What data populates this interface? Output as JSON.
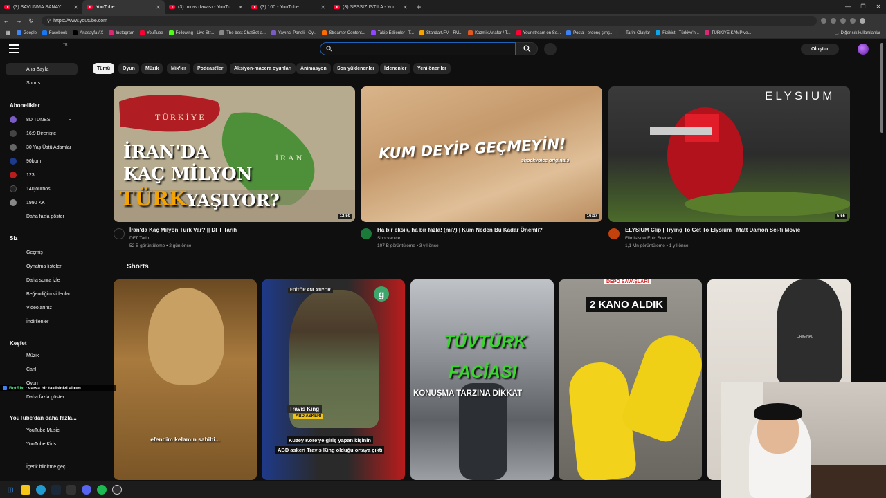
{
  "browser": {
    "tabs": [
      {
        "title": "(3) SAVUNMA SANAYİ UZMANI, E"
      },
      {
        "title": "YouTube"
      },
      {
        "title": "(3) miras davası - YouTube"
      },
      {
        "title": "(3) 100 - YouTube"
      },
      {
        "title": "(3) SESSİZ İSTİLA - YouTube"
      }
    ],
    "url": "https://www.youtube.com",
    "bookmarks": [
      "Google",
      "Facebook",
      "Anasayfa / X",
      "Instagram",
      "YouTube",
      "Following - Live Str...",
      "The best ChatBot a...",
      "Yayıncı Paneli - Oy...",
      "Streamer Content...",
      "Takip Edilenler - T...",
      "Standart.FM - FM...",
      "Kozmik Anafor / T...",
      "Your stream on So...",
      "Posta - erdenç şimş...",
      "Tarihi Olaylar",
      "Fizikist - Türkiye'n...",
      "TÜRKİYE KAMP ve..."
    ],
    "other_bookmarks": "Diğer sık kullanılanlar"
  },
  "header": {
    "country": "TR",
    "search_value": "",
    "create_label": "Oluştur"
  },
  "sidebar": {
    "home": "Ana Sayfa",
    "shorts": "Shorts",
    "subs_header": "Abonelikler",
    "subscriptions": [
      "8D TUNES",
      "16:9 Direnişte",
      "30 Yaş Üstü Adamlar",
      "90bpm",
      "123",
      "140journos",
      "1990 KK"
    ],
    "show_more": "Daha fazla göster",
    "you_header": "Siz",
    "you_items": [
      "Geçmiş",
      "Oynatma listeleri",
      "Daha sonra izle",
      "Beğendiğim videolar",
      "Videolarınız",
      "İndirilenler"
    ],
    "explore_header": "Keşfet",
    "explore_items": [
      "Müzik",
      "Canlı",
      "Oyun"
    ],
    "explore_more": "Daha fazla göster",
    "more_yt_header": "YouTube'dan daha fazla...",
    "more_yt_items": [
      "YouTube Music",
      "YouTube Kids"
    ],
    "report": "İçerik bildirme geç..."
  },
  "chips": [
    "Tümü",
    "Oyun",
    "Müzik",
    "Mix'ler",
    "Podcast'ler",
    "Aksiyon-macera oyunları",
    "Animasyon",
    "Son yüklenenler",
    "İzlenenler",
    "Yeni öneriler"
  ],
  "videos": [
    {
      "title": "İran'da Kaç Milyon Türk Var? || DFT Tarih",
      "channel": "DFT Tarih",
      "meta": "52 B görüntüleme • 2 gün önce",
      "duration": "12:50",
      "thumb_text_1": "İRAN'DA",
      "thumb_text_2": "KAÇ MİLYON",
      "thumb_text_3": "TÜRK",
      "thumb_text_4": "YAŞIYOR?",
      "map_label_1": "TÜRKİYE",
      "map_label_2": "İRAN"
    },
    {
      "title": "Ha bir eksik, ha bir fazla! (mı?) | Kum Neden Bu Kadar Önemli?",
      "channel": "Shockvoice",
      "meta": "107 B görüntüleme • 3 yıl önce",
      "duration": "16:17",
      "thumb_text_1": "KUM DEYİP GEÇMEYİN!",
      "thumb_text_2": "shockvoice originals"
    },
    {
      "title": "ELYSIUM Clip | Trying To Get To Elysium | Matt Damon Sci-fi Movie",
      "channel": "FilmIsNow Epic Scenes",
      "meta": "1,1 Mn görüntüleme • 1 yıl önce",
      "duration": "5:55",
      "thumb_text_1": "ELYSIUM"
    }
  ],
  "shorts_title": "Shorts",
  "shorts": [
    {
      "caption": "efendim kelamın sahibi..."
    },
    {
      "tag": "EDİTÖR ANLATIYOR",
      "name": "Travis King",
      "rank": "ABD ASKERİ",
      "caption_1": "Kuzey Kore'ye giriş yapan kişinin",
      "caption_2": "ABD askeri Travis King olduğu ortaya çıktı"
    },
    {
      "text_1": "TÜVTÜRK",
      "text_2": "FACİASI",
      "text_3": "KONUŞMA TARZINA DİKKAT"
    },
    {
      "banner": "DEPO SAVAŞLARI",
      "text_1": "2 KANO ALDIK"
    },
    {
      "text_1": "ORIGINAL"
    }
  ],
  "chat": {
    "user": "BotRix",
    "message": ": varsa bir takibinizi alırım."
  },
  "colors": {
    "accent": "#ff0033",
    "background": "#0f0f0f",
    "chip": "#272727"
  }
}
